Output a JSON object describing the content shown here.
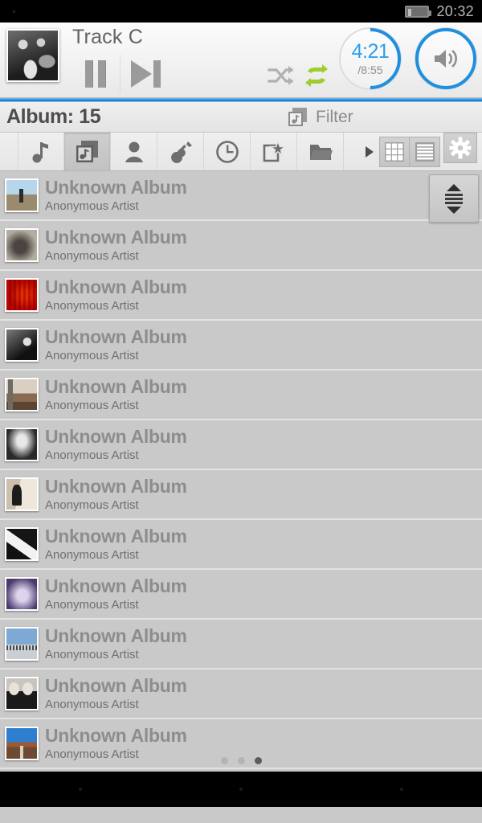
{
  "statusbar": {
    "time": "20:32",
    "battery_icon": "battery-icon"
  },
  "player": {
    "track_title": "Track C",
    "cover_name": "album-art",
    "pause_label": "Pause",
    "next_label": "Next track",
    "shuffle": {
      "name": "shuffle-icon",
      "active": false,
      "color": "#9b9b9b"
    },
    "repeat": {
      "name": "repeat-icon",
      "active": true,
      "color": "#9fcc2e"
    },
    "time": {
      "current": "4:21",
      "total": "/8:55",
      "accent": "#2e9fe8",
      "progress_pct": 49
    },
    "volume": {
      "name": "volume-icon",
      "accent": "#1f8fe0"
    }
  },
  "progress": {
    "accent": "#1f8fe0",
    "pct": 100
  },
  "album_header": {
    "title": "Album: 15",
    "filter_label": "Filter",
    "filter_icon": "album-music-icon"
  },
  "tabs": [
    {
      "name": "tab-tracks",
      "icon": "music-note-icon",
      "active": false
    },
    {
      "name": "tab-albums",
      "icon": "album-icon",
      "active": true
    },
    {
      "name": "tab-artists",
      "icon": "person-icon",
      "active": false
    },
    {
      "name": "tab-genres",
      "icon": "guitar-icon",
      "active": false
    },
    {
      "name": "tab-recent",
      "icon": "clock-icon",
      "active": false
    },
    {
      "name": "tab-playlists",
      "icon": "playlist-star-icon",
      "active": false
    },
    {
      "name": "tab-folders",
      "icon": "folder-icon",
      "active": false
    }
  ],
  "toolbar_right": {
    "more_icon": "arrow-right-icon",
    "grid_icon": "grid-view-icon",
    "list_icon": "list-view-icon",
    "gear_icon": "settings-gear-icon"
  },
  "list": {
    "scroll_handle": "scroll-handle",
    "rows": [
      {
        "title": "Unknown Album",
        "artist": "Anonymous Artist",
        "art": "art-1"
      },
      {
        "title": "Unknown Album",
        "artist": "Anonymous Artist",
        "art": "art-2"
      },
      {
        "title": "Unknown Album",
        "artist": "Anonymous Artist",
        "art": "art-3"
      },
      {
        "title": "Unknown Album",
        "artist": "Anonymous Artist",
        "art": "art-4"
      },
      {
        "title": "Unknown Album",
        "artist": "Anonymous Artist",
        "art": "art-5"
      },
      {
        "title": "Unknown Album",
        "artist": "Anonymous Artist",
        "art": "art-6"
      },
      {
        "title": "Unknown Album",
        "artist": "Anonymous Artist",
        "art": "art-7"
      },
      {
        "title": "Unknown Album",
        "artist": "Anonymous Artist",
        "art": "art-8"
      },
      {
        "title": "Unknown Album",
        "artist": "Anonymous Artist",
        "art": "art-9"
      },
      {
        "title": "Unknown Album",
        "artist": "Anonymous Artist",
        "art": "art-10"
      },
      {
        "title": "Unknown Album",
        "artist": "Anonymous Artist",
        "art": "art-11"
      },
      {
        "title": "Unknown Album",
        "artist": "Anonymous Artist",
        "art": "art-12"
      }
    ]
  },
  "page_dots": {
    "count": 3,
    "active_index": 2
  }
}
